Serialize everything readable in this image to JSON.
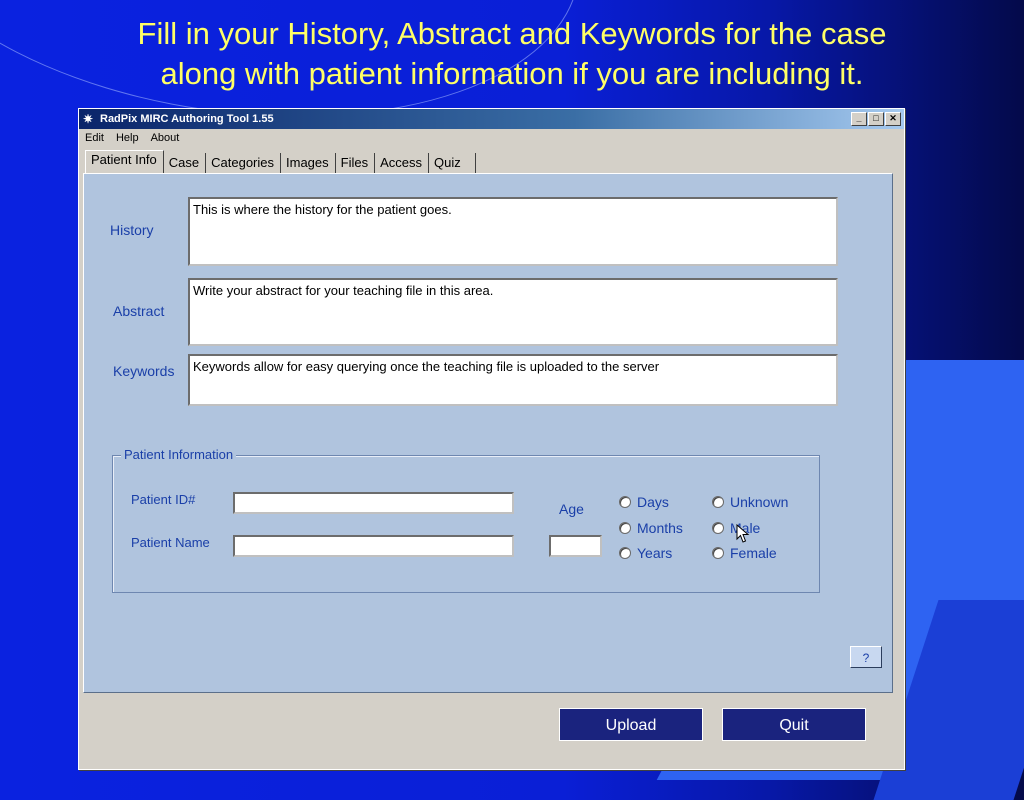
{
  "slide": {
    "title_line1": "Fill in your History, Abstract and Keywords for the case",
    "title_line2": "along with patient information if you are including it."
  },
  "window": {
    "title": "RadPix MIRC Authoring Tool 1.55",
    "minimize": "_",
    "maximize": "□",
    "close": "✕"
  },
  "menu": {
    "items": [
      "Edit",
      "Help",
      "About"
    ]
  },
  "tabs": [
    "Patient Info",
    "Case",
    "Categories",
    "Images",
    "Files",
    "Access",
    "Quiz"
  ],
  "form": {
    "history_label": "History",
    "history_value": "This is where the history for the patient goes.",
    "abstract_label": "Abstract",
    "abstract_value": "Write your abstract for your teaching file in this area.",
    "keywords_label": "Keywords",
    "keywords_value": "Keywords allow for easy querying once the teaching file is uploaded to the server"
  },
  "patient": {
    "group_title": "Patient Information",
    "id_label": "Patient ID#",
    "id_value": "",
    "name_label": "Patient Name",
    "name_value": "",
    "age_label": "Age",
    "age_value": "",
    "age_units": [
      "Days",
      "Months",
      "Years"
    ],
    "sex_options": [
      "Unknown",
      "Male",
      "Female"
    ]
  },
  "buttons": {
    "help": "?",
    "upload": "Upload",
    "quit": "Quit"
  },
  "colors": {
    "accent": "#1a237e",
    "title_text": "#ffff66",
    "panel": "#b0c4de"
  },
  "icons": {
    "app": "radpix-app-icon",
    "cursor": "mouse-pointer-icon"
  }
}
